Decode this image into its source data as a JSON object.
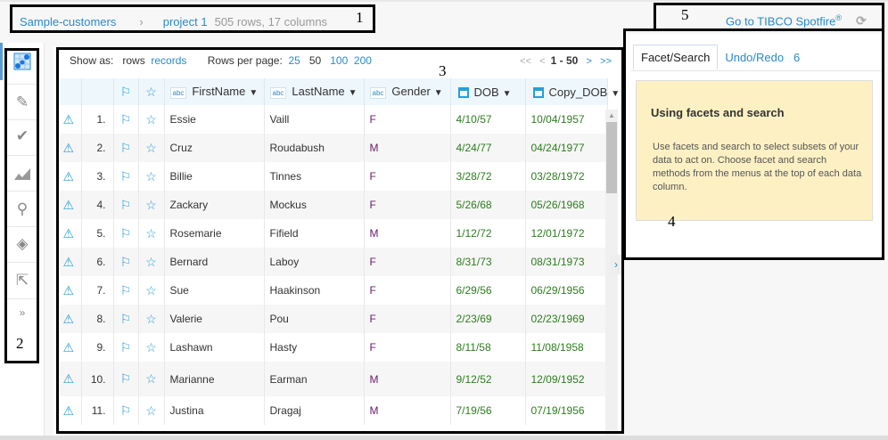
{
  "breadcrumb": {
    "dataset": "Sample-customers",
    "separator": "›",
    "project": "project 1",
    "meta": "505 rows, 17 columns"
  },
  "header": {
    "goto_label": "Go to TIBCO Spotfire",
    "reg": "®",
    "refresh_icon": "⟳"
  },
  "sidebar": {
    "items": [
      "grid-view",
      "transform",
      "check",
      "chart",
      "map",
      "layers",
      "export"
    ],
    "more": "»"
  },
  "toolbar": {
    "show_as": "Show as:",
    "rows": "rows",
    "records": "records",
    "rows_per_page": "Rows per page:",
    "sizes": [
      "25",
      "50",
      "100",
      "200"
    ]
  },
  "pager": {
    "first": "<<",
    "prev": "<",
    "range": "1 - 50",
    "next": ">",
    "last": ">>"
  },
  "columns": [
    "FirstName",
    "LastName",
    "Gender",
    "DOB",
    "Copy_DOB"
  ],
  "rows": [
    {
      "n": "1.",
      "first": "Essie",
      "last": "Vaill",
      "g": "F",
      "dob": "4/10/57",
      "copy": "10/04/1957"
    },
    {
      "n": "2.",
      "first": "Cruz",
      "last": "Roudabush",
      "g": "M",
      "dob": "4/24/77",
      "copy": "04/24/1977"
    },
    {
      "n": "3.",
      "first": "Billie",
      "last": "Tinnes",
      "g": "F",
      "dob": "3/28/72",
      "copy": "03/28/1972"
    },
    {
      "n": "4.",
      "first": "Zackary",
      "last": "Mockus",
      "g": "F",
      "dob": "5/26/68",
      "copy": "05/26/1968"
    },
    {
      "n": "5.",
      "first": "Rosemarie",
      "last": "Fifield",
      "g": "M",
      "dob": "1/12/72",
      "copy": "12/01/1972"
    },
    {
      "n": "6.",
      "first": "Bernard",
      "last": "Laboy",
      "g": "F",
      "dob": "8/31/73",
      "copy": "08/31/1973"
    },
    {
      "n": "7.",
      "first": "Sue",
      "last": "Haakinson",
      "g": "F",
      "dob": "6/29/56",
      "copy": "06/29/1956"
    },
    {
      "n": "8.",
      "first": "Valerie",
      "last": "Pou",
      "g": "F",
      "dob": "2/23/69",
      "copy": "02/23/1969"
    },
    {
      "n": "9.",
      "first": "Lashawn",
      "last": "Hasty",
      "g": "F",
      "dob": "8/11/58",
      "copy": "11/08/1958"
    },
    {
      "n": "10.",
      "first": "Marianne",
      "last": "Earman",
      "g": "M",
      "dob": "9/12/52",
      "copy": "12/09/1952"
    },
    {
      "n": "11.",
      "first": "Justina",
      "last": "Dragaj",
      "g": "M",
      "dob": "7/19/56",
      "copy": "07/19/1956"
    }
  ],
  "panel": {
    "tab_facet": "Facet/Search",
    "tab_undo": "Undo/Redo",
    "undo_count": "6",
    "help_title": "Using facets and search",
    "help_text": "Use facets and search to select subsets of your data to act on. Choose facet and search methods from the menus at the top of each data column."
  },
  "annotations": [
    "1",
    "2",
    "3",
    "4",
    "5"
  ]
}
